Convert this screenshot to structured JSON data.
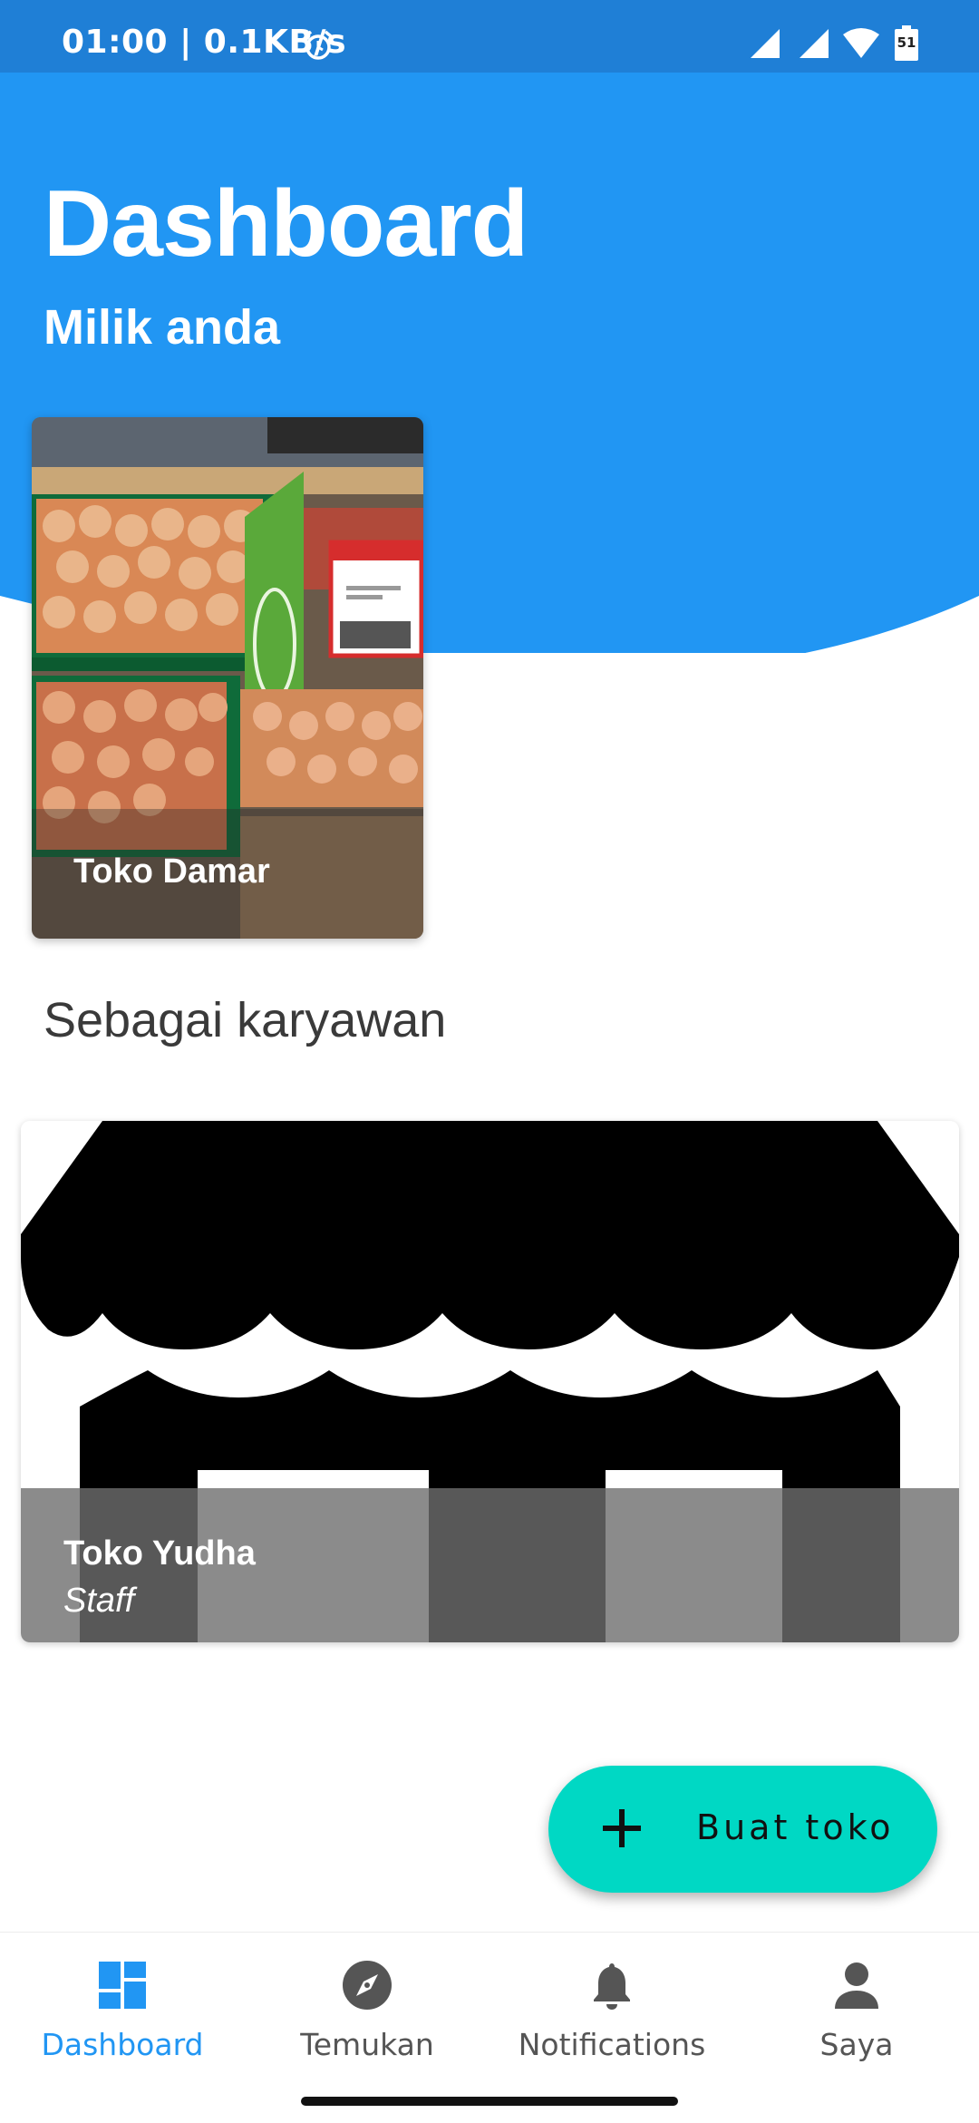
{
  "status_bar": {
    "time_speed": "01:00 | 0.1KB/s",
    "battery": "51",
    "icons": [
      "alarm-icon",
      "signal-icon",
      "signal-icon",
      "wifi-icon",
      "battery-icon"
    ]
  },
  "header": {
    "title": "Dashboard",
    "subtitle": "Milik anda",
    "background_color": "#2196f3"
  },
  "owned_stores": [
    {
      "name": "Toko Damar",
      "image": "grocery-produce-photo"
    }
  ],
  "employee_section": {
    "title": "Sebagai karyawan",
    "stores": [
      {
        "name": "Toko Yudha",
        "role": "Staff",
        "image": "storefront-icon"
      }
    ]
  },
  "fab": {
    "label": "Buat toko",
    "icon": "plus-icon",
    "color": "#00d8c4"
  },
  "bottom_nav": {
    "active_color": "#2196f3",
    "items": [
      {
        "label": "Dashboard",
        "icon": "dashboard-icon",
        "active": true
      },
      {
        "label": "Temukan",
        "icon": "compass-icon",
        "active": false
      },
      {
        "label": "Notifications",
        "icon": "bell-icon",
        "active": false
      },
      {
        "label": "Saya",
        "icon": "person-icon",
        "active": false
      }
    ]
  }
}
